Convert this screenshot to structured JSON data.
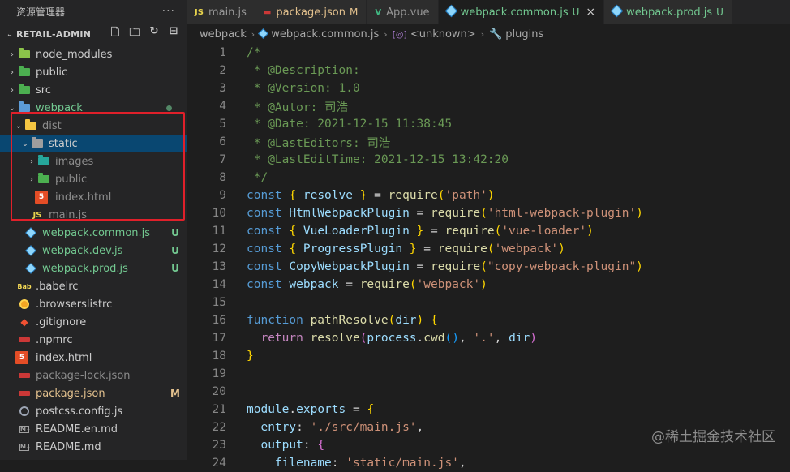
{
  "sidebar": {
    "title": "资源管理器",
    "more": "···",
    "project": "RETAIL-ADMIN",
    "tree": [
      {
        "label": "node_modules",
        "indent": 1,
        "chevron": "›",
        "icon": "folder",
        "iconColor": "#8bc34a",
        "color": "default",
        "badge": ""
      },
      {
        "label": "public",
        "indent": 1,
        "chevron": "›",
        "icon": "folder",
        "iconColor": "#4caf50",
        "color": "default",
        "badge": ""
      },
      {
        "label": "src",
        "indent": 1,
        "chevron": "›",
        "icon": "folder",
        "iconColor": "#4caf50",
        "color": "default",
        "badge": ""
      },
      {
        "label": "webpack",
        "indent": 1,
        "chevron": "⌄",
        "icon": "folder",
        "iconColor": "#5c9bd6",
        "color": "green",
        "badge": "dot"
      },
      {
        "label": "dist",
        "indent": 2,
        "chevron": "⌄",
        "icon": "folder",
        "iconColor": "#f4c542",
        "color": "gray",
        "badge": ""
      },
      {
        "label": "static",
        "indent": 3,
        "chevron": "⌄",
        "icon": "folder",
        "iconColor": "#9e9e9e",
        "color": "default",
        "badge": "",
        "selected": true
      },
      {
        "label": "images",
        "indent": 4,
        "chevron": "›",
        "icon": "folder",
        "iconColor": "#26a69a",
        "color": "gray",
        "badge": ""
      },
      {
        "label": "public",
        "indent": 4,
        "chevron": "›",
        "icon": "folder",
        "iconColor": "#4caf50",
        "color": "gray",
        "badge": ""
      },
      {
        "label": "index.html",
        "indent": 4,
        "chevron": "",
        "icon": "html",
        "iconColor": "#e44d26",
        "color": "gray",
        "badge": ""
      },
      {
        "label": "main.js",
        "indent": 3,
        "chevron": "",
        "icon": "js",
        "iconColor": "#e8d44d",
        "color": "gray",
        "badge": ""
      },
      {
        "label": "webpack.common.js",
        "indent": 2,
        "chevron": "",
        "icon": "cube",
        "iconColor": "#8ed6fb",
        "color": "green",
        "badge": "U"
      },
      {
        "label": "webpack.dev.js",
        "indent": 2,
        "chevron": "",
        "icon": "cube",
        "iconColor": "#8ed6fb",
        "color": "green",
        "badge": "U"
      },
      {
        "label": "webpack.prod.js",
        "indent": 2,
        "chevron": "",
        "icon": "cube",
        "iconColor": "#8ed6fb",
        "color": "green",
        "badge": "U"
      },
      {
        "label": ".babelrc",
        "indent": 1,
        "chevron": "",
        "icon": "babel",
        "iconColor": "#f5da55",
        "color": "default",
        "badge": ""
      },
      {
        "label": ".browserslistrc",
        "indent": 1,
        "chevron": "",
        "icon": "browsers",
        "iconColor": "#f5a623",
        "color": "default",
        "badge": ""
      },
      {
        "label": ".gitignore",
        "indent": 1,
        "chevron": "",
        "icon": "git",
        "iconColor": "#f05133",
        "color": "default",
        "badge": ""
      },
      {
        "label": ".npmrc",
        "indent": 1,
        "chevron": "",
        "icon": "npm",
        "iconColor": "#cb3837",
        "color": "default",
        "badge": ""
      },
      {
        "label": "index.html",
        "indent": 1,
        "chevron": "",
        "icon": "html",
        "iconColor": "#e44d26",
        "color": "default",
        "badge": ""
      },
      {
        "label": "package-lock.json",
        "indent": 1,
        "chevron": "",
        "icon": "npm",
        "iconColor": "#cb3837",
        "color": "gray",
        "badge": ""
      },
      {
        "label": "package.json",
        "indent": 1,
        "chevron": "",
        "icon": "npm",
        "iconColor": "#cb3837",
        "color": "yellow",
        "badge": "M"
      },
      {
        "label": "postcss.config.js",
        "indent": 1,
        "chevron": "",
        "icon": "gear",
        "iconColor": "#9da5b4",
        "color": "default",
        "badge": ""
      },
      {
        "label": "README.en.md",
        "indent": 1,
        "chevron": "",
        "icon": "md",
        "iconColor": "#a0a0a0",
        "color": "default",
        "badge": ""
      },
      {
        "label": "README.md",
        "indent": 1,
        "chevron": "",
        "icon": "md",
        "iconColor": "#a0a0a0",
        "color": "default",
        "badge": ""
      }
    ]
  },
  "tabs": [
    {
      "label": "main.js",
      "icon": "js",
      "iconText": "JS",
      "badge": "",
      "active": false,
      "color": "#969696"
    },
    {
      "label": "package.json",
      "icon": "json",
      "iconText": "{}",
      "badge": "M",
      "active": false,
      "color": "#e2c08d"
    },
    {
      "label": "App.vue",
      "icon": "vue",
      "iconText": "V",
      "badge": "",
      "active": false,
      "color": "#969696"
    },
    {
      "label": "webpack.common.js",
      "icon": "wp",
      "iconText": "",
      "badge": "U",
      "active": true,
      "color": "#73c991",
      "close": "×"
    },
    {
      "label": "webpack.prod.js",
      "icon": "wp",
      "iconText": "",
      "badge": "U",
      "active": false,
      "color": "#73c991"
    }
  ],
  "breadcrumb": {
    "items": [
      "webpack",
      "webpack.common.js",
      "<unknown>",
      "plugins"
    ]
  },
  "code_lines": [
    [
      [
        "/*",
        "tk-comment"
      ]
    ],
    [
      [
        " * @Description:",
        "tk-comment"
      ]
    ],
    [
      [
        " * @Version: 1.0",
        "tk-comment"
      ]
    ],
    [
      [
        " * @Autor: 司浩",
        "tk-comment"
      ]
    ],
    [
      [
        " * @Date: 2021-12-15 11:38:45",
        "tk-comment"
      ]
    ],
    [
      [
        " * @LastEditors: 司浩",
        "tk-comment"
      ]
    ],
    [
      [
        " * @LastEditTime: 2021-12-15 13:42:20",
        "tk-comment"
      ]
    ],
    [
      [
        " */",
        "tk-comment"
      ]
    ],
    [
      [
        "const ",
        "tk-kw"
      ],
      [
        "{ ",
        "tk-brace1"
      ],
      [
        "resolve",
        "tk-var"
      ],
      [
        " } ",
        "tk-brace1"
      ],
      [
        "= ",
        "tk-def"
      ],
      [
        "require",
        "tk-fn"
      ],
      [
        "(",
        "tk-brace1"
      ],
      [
        "'path'",
        "tk-str"
      ],
      [
        ")",
        "tk-brace1"
      ]
    ],
    [
      [
        "const ",
        "tk-kw"
      ],
      [
        "HtmlWebpackPlugin",
        "tk-var"
      ],
      [
        " = ",
        "tk-def"
      ],
      [
        "require",
        "tk-fn"
      ],
      [
        "(",
        "tk-brace1"
      ],
      [
        "'html-webpack-plugin'",
        "tk-str"
      ],
      [
        ")",
        "tk-brace1"
      ]
    ],
    [
      [
        "const ",
        "tk-kw"
      ],
      [
        "{ ",
        "tk-brace1"
      ],
      [
        "VueLoaderPlugin",
        "tk-var"
      ],
      [
        " } ",
        "tk-brace1"
      ],
      [
        "= ",
        "tk-def"
      ],
      [
        "require",
        "tk-fn"
      ],
      [
        "(",
        "tk-brace1"
      ],
      [
        "'vue-loader'",
        "tk-str"
      ],
      [
        ")",
        "tk-brace1"
      ]
    ],
    [
      [
        "const ",
        "tk-kw"
      ],
      [
        "{ ",
        "tk-brace1"
      ],
      [
        "ProgressPlugin",
        "tk-var"
      ],
      [
        " } ",
        "tk-brace1"
      ],
      [
        "= ",
        "tk-def"
      ],
      [
        "require",
        "tk-fn"
      ],
      [
        "(",
        "tk-brace1"
      ],
      [
        "'webpack'",
        "tk-str"
      ],
      [
        ")",
        "tk-brace1"
      ]
    ],
    [
      [
        "const ",
        "tk-kw"
      ],
      [
        "CopyWebpackPlugin",
        "tk-var"
      ],
      [
        " = ",
        "tk-def"
      ],
      [
        "require",
        "tk-fn"
      ],
      [
        "(",
        "tk-brace1"
      ],
      [
        "\"copy-webpack-plugin\"",
        "tk-str"
      ],
      [
        ")",
        "tk-brace1"
      ]
    ],
    [
      [
        "const ",
        "tk-kw"
      ],
      [
        "webpack",
        "tk-var"
      ],
      [
        " = ",
        "tk-def"
      ],
      [
        "require",
        "tk-fn"
      ],
      [
        "(",
        "tk-brace1"
      ],
      [
        "'webpack'",
        "tk-str"
      ],
      [
        ")",
        "tk-brace1"
      ]
    ],
    [],
    [
      [
        "function ",
        "tk-kw"
      ],
      [
        "pathResolve",
        "tk-fn"
      ],
      [
        "(",
        "tk-brace1"
      ],
      [
        "dir",
        "tk-var"
      ],
      [
        ") ",
        "tk-brace1"
      ],
      [
        "{",
        "tk-brace1"
      ]
    ],
    [
      [
        "  return ",
        "tk-ctrl"
      ],
      [
        "resolve",
        "tk-fn"
      ],
      [
        "(",
        "tk-brace2"
      ],
      [
        "process",
        "tk-var"
      ],
      [
        ".",
        "tk-def"
      ],
      [
        "cwd",
        "tk-fn"
      ],
      [
        "()",
        "tk-brace3"
      ],
      [
        ", ",
        "tk-def"
      ],
      [
        "'.'",
        "tk-str"
      ],
      [
        ", ",
        "tk-def"
      ],
      [
        "dir",
        "tk-var"
      ],
      [
        ")",
        "tk-brace2"
      ]
    ],
    [
      [
        "}",
        "tk-brace1"
      ]
    ],
    [],
    [],
    [
      [
        "module",
        "tk-var"
      ],
      [
        ".",
        "tk-def"
      ],
      [
        "exports",
        "tk-var"
      ],
      [
        " = ",
        "tk-def"
      ],
      [
        "{",
        "tk-brace1"
      ]
    ],
    [
      [
        "  entry",
        "tk-var"
      ],
      [
        ": ",
        "tk-def"
      ],
      [
        "'./src/main.js'",
        "tk-str"
      ],
      [
        ",",
        "tk-def"
      ]
    ],
    [
      [
        "  output",
        "tk-var"
      ],
      [
        ": ",
        "tk-def"
      ],
      [
        "{",
        "tk-brace2"
      ]
    ],
    [
      [
        "    filename",
        "tk-var"
      ],
      [
        ": ",
        "tk-def"
      ],
      [
        "'static/main.js'",
        "tk-str"
      ],
      [
        ",",
        "tk-def"
      ]
    ]
  ],
  "watermark": "@稀土掘金技术社区",
  "colors": {
    "highlight_box": "#e0202a",
    "selected_row": "#094771",
    "untracked": "#73c991",
    "modified": "#e2c08d"
  }
}
